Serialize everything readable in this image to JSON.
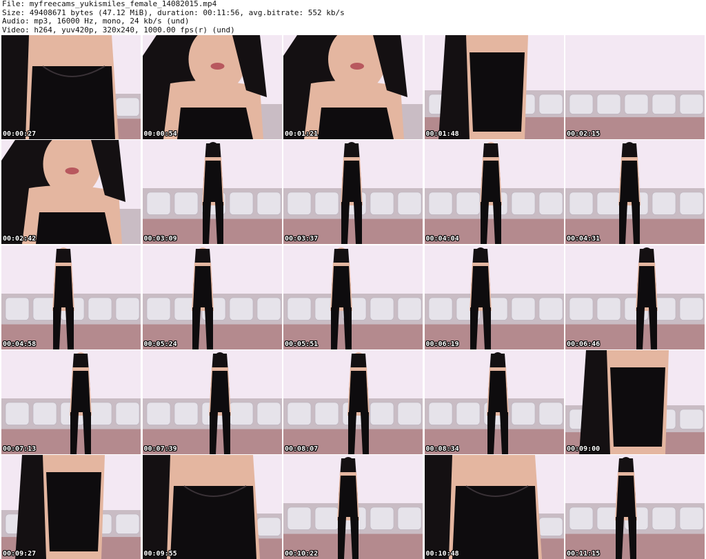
{
  "header": {
    "file_line": "File: myfreecams_yukismiles_female_14082015.mp4",
    "size_line": "Size: 49408671 bytes (47.12 MiB), duration: 00:11:56, avg.bitrate: 552 kb/s",
    "audio_line": "Audio: mp3, 16000 Hz, mono, 24 kb/s (und)",
    "video_line": "Video: h264, yuv420p, 320x240, 1000.00 fps(r) (und)"
  },
  "frames": [
    {
      "time": "00:00:27",
      "shot": "closeup-torso"
    },
    {
      "time": "00:00:54",
      "shot": "closeup-face"
    },
    {
      "time": "00:01:21",
      "shot": "closeup-face"
    },
    {
      "time": "00:01:48",
      "shot": "torso"
    },
    {
      "time": "00:02:15",
      "shot": "empty-room"
    },
    {
      "time": "00:02:42",
      "shot": "closeup-face"
    },
    {
      "time": "00:03:09",
      "shot": "back-view"
    },
    {
      "time": "00:03:37",
      "shot": "back-view"
    },
    {
      "time": "00:04:04",
      "shot": "front-standing"
    },
    {
      "time": "00:04:31",
      "shot": "back-view"
    },
    {
      "time": "00:04:58",
      "shot": "side-view"
    },
    {
      "time": "00:05:24",
      "shot": "front-standing"
    },
    {
      "time": "00:05:51",
      "shot": "side-view"
    },
    {
      "time": "00:06:19",
      "shot": "back-view"
    },
    {
      "time": "00:06:46",
      "shot": "back-view"
    },
    {
      "time": "00:07:13",
      "shot": "front-standing"
    },
    {
      "time": "00:07:39",
      "shot": "back-view"
    },
    {
      "time": "00:08:07",
      "shot": "side-view"
    },
    {
      "time": "00:08:34",
      "shot": "back-view"
    },
    {
      "time": "00:09:00",
      "shot": "torso"
    },
    {
      "time": "00:09:27",
      "shot": "torso"
    },
    {
      "time": "00:09:55",
      "shot": "closeup-torso"
    },
    {
      "time": "00:10:22",
      "shot": "back-view"
    },
    {
      "time": "00:10:48",
      "shot": "closeup-torso"
    },
    {
      "time": "00:11:15",
      "shot": "back-view"
    }
  ],
  "colors": {
    "wall": "#f3e8f3",
    "sofa_base": "#c9bcc4",
    "sofa_seat": "#b48a8e",
    "cushion": "#e6e3ea",
    "hair": "#141012",
    "skin": "#e4b6a0",
    "lingerie": "#0e0c0e",
    "timestamp_text": "#ffffff"
  }
}
